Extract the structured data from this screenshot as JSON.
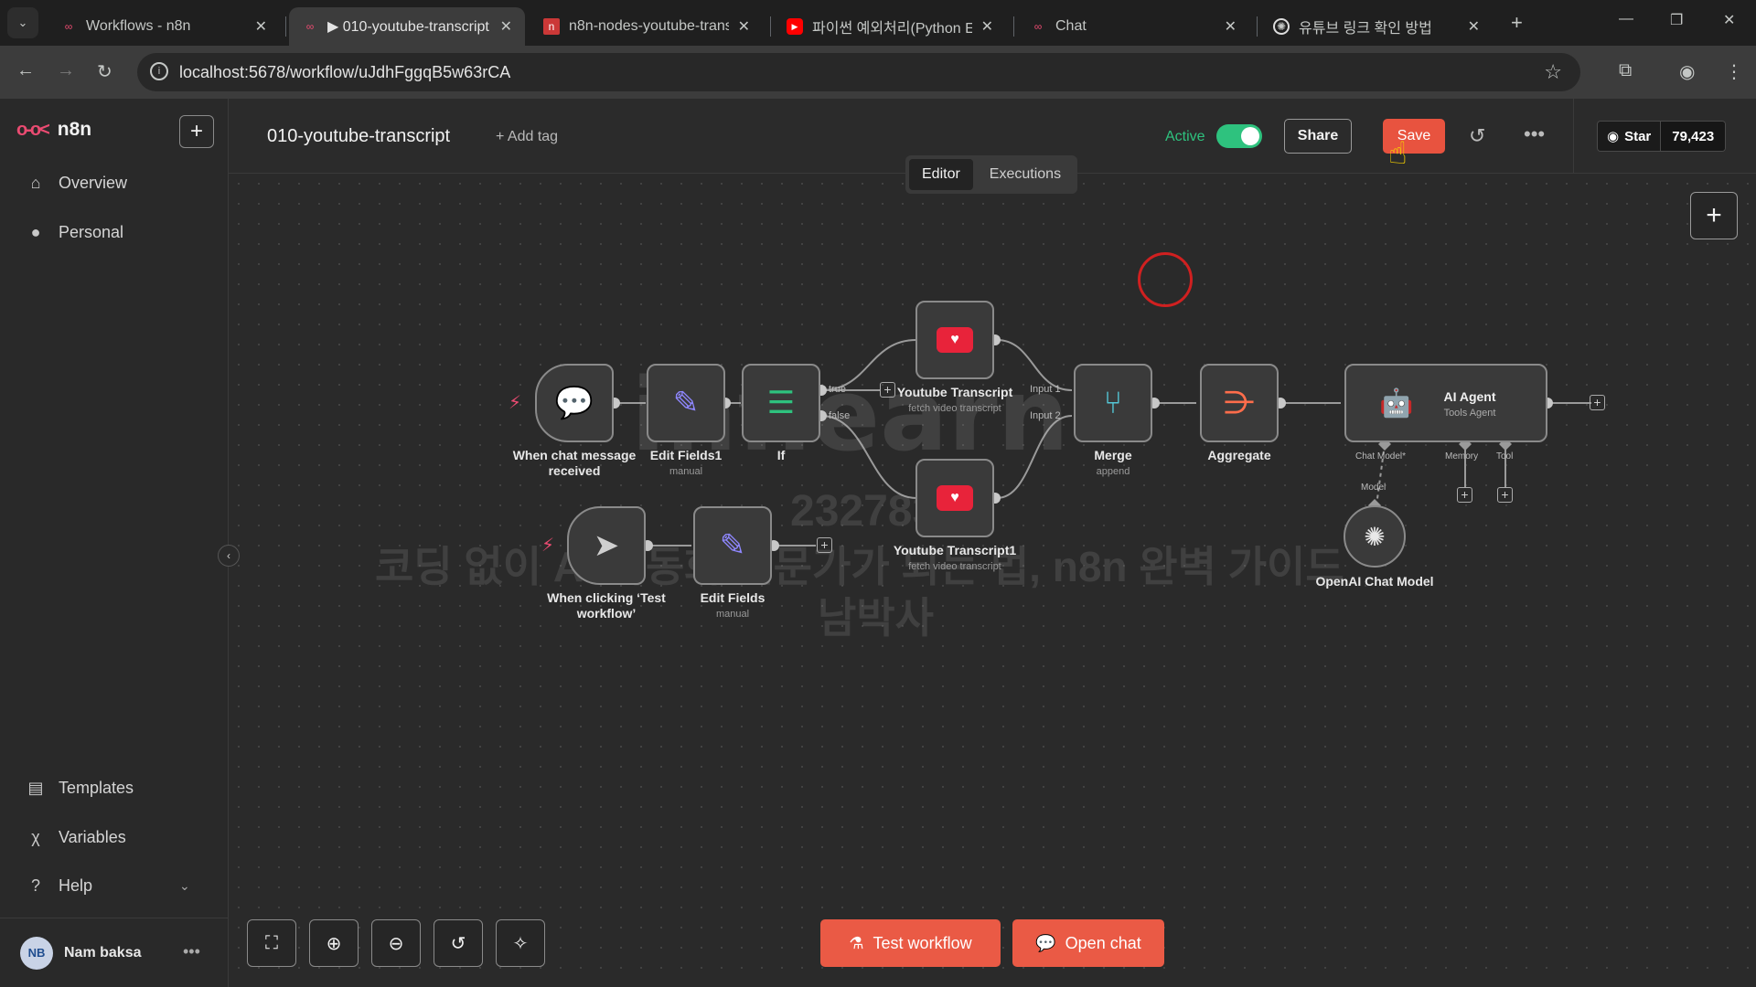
{
  "browser": {
    "tabs": [
      {
        "title": "Workflows - n8n",
        "icon": "n8n-icon"
      },
      {
        "title": "▶ 010-youtube-transcript",
        "icon": "n8n-icon"
      },
      {
        "title": "n8n-nodes-youtube-trans",
        "icon": "npm-icon"
      },
      {
        "title": "파이썬 예외처리(Python E",
        "icon": "youtube-icon"
      },
      {
        "title": "Chat",
        "icon": "n8n-icon"
      },
      {
        "title": "유튜브 링크 확인 방법",
        "icon": "openai-icon"
      }
    ],
    "url": "localhost:5678/workflow/uJdhFggqB5w63rCA"
  },
  "sidebar": {
    "brand": "n8n",
    "top_items": [
      {
        "label": "Overview",
        "icon": "home-icon"
      },
      {
        "label": "Personal",
        "icon": "user-icon"
      }
    ],
    "bottom_items": [
      {
        "label": "Templates",
        "icon": "box-icon"
      },
      {
        "label": "Variables",
        "icon": "variable-icon"
      },
      {
        "label": "Help",
        "icon": "help-icon"
      }
    ],
    "user": {
      "initials": "NB",
      "name": "Nam baksa"
    }
  },
  "header": {
    "workflow_name": "010-youtube-transcript",
    "add_tag": "+ Add tag",
    "active_label": "Active",
    "active": true,
    "share": "Share",
    "save": "Save",
    "github_star": "Star",
    "github_count": "79,423",
    "tabs": [
      "Editor",
      "Executions"
    ],
    "selected_tab": "Editor"
  },
  "canvas": {
    "nodes": {
      "chat_trigger": {
        "label1": "When chat message",
        "label2": "received"
      },
      "edit_fields1": {
        "label": "Edit Fields1",
        "sub": "manual"
      },
      "if": {
        "label": "If",
        "out_true": "true",
        "out_false": "false"
      },
      "yt1": {
        "label": "Youtube Transcript",
        "sub": "fetch video transcript"
      },
      "yt2": {
        "label": "Youtube Transcript1",
        "sub": "fetch video transcript"
      },
      "merge": {
        "label": "Merge",
        "sub": "append",
        "in1": "Input 1",
        "in2": "Input 2"
      },
      "aggregate": {
        "label": "Aggregate"
      },
      "agent": {
        "label": "AI Agent",
        "sub": "Tools Agent",
        "port_chat": "Chat Model*",
        "port_memory": "Memory",
        "port_tool": "Tool"
      },
      "openai": {
        "label": "OpenAI Chat Model",
        "port": "Model"
      },
      "manual_trigger": {
        "label1": "When clicking ‘Test",
        "label2": "workflow’"
      },
      "edit_fields": {
        "label": "Edit Fields",
        "sub": "manual"
      }
    },
    "watermark": {
      "brand": "inflearn",
      "id": "232783",
      "line1": "코딩 없이 AI 자동화 전문가가 되는 법, n8n 완벽 가이드",
      "line2": "남박사"
    }
  },
  "footer": {
    "test_workflow": "Test workflow",
    "open_chat": "Open chat"
  },
  "colors": {
    "accent": "#ea4b71",
    "active_green": "#2ec27e",
    "save_red": "#e8533f",
    "cta": "#ea5a45"
  }
}
